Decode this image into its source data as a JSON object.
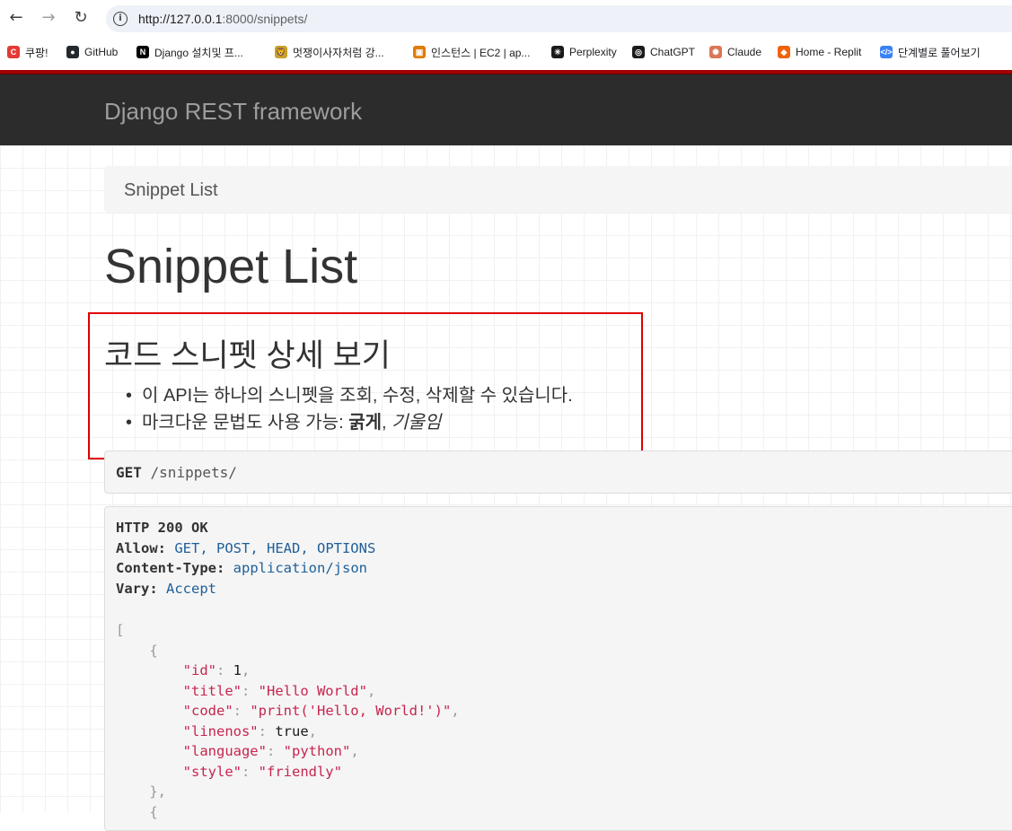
{
  "browser": {
    "url_host": "http://127.0.0.1",
    "url_rest": ":8000/snippets/",
    "bookmarks": [
      {
        "label": "쿠팡!",
        "color": "#e53935",
        "glyph": "C"
      },
      {
        "label": "GitHub",
        "color": "#24292e",
        "glyph": "●"
      },
      {
        "label": "Django 설치및 프...",
        "color": "#000000",
        "glyph": "N"
      },
      {
        "label": "멋쟁이사자처럼 강...",
        "color": "#c9a227",
        "glyph": "🦁"
      },
      {
        "label": "인스턴스 | EC2 | ap...",
        "color": "#e07b00",
        "glyph": "▣"
      },
      {
        "label": "Perplexity",
        "color": "#1a1a1a",
        "glyph": "✳"
      },
      {
        "label": "ChatGPT",
        "color": "#1a1a1a",
        "glyph": "◎"
      },
      {
        "label": "Claude",
        "color": "#d97757",
        "glyph": "✺"
      },
      {
        "label": "Home - Replit",
        "color": "#f26207",
        "glyph": "◆"
      },
      {
        "label": "단계별로 풀어보기",
        "color": "#3b82f6",
        "glyph": "</>"
      }
    ]
  },
  "navbar": {
    "brand": "Django REST framework"
  },
  "breadcrumb": "Snippet List",
  "page_title": "Snippet List",
  "description": {
    "title": "코드 스니펫 상세 보기",
    "item1": "이 API는 하나의 스니펫을 조회, 수정, 삭제할 수 있습니다.",
    "item2_prefix": "마크다운 문법도 사용 가능: ",
    "item2_bold": "굵게",
    "item2_sep": ", ",
    "item2_italic": "기울임"
  },
  "request": {
    "method": "GET",
    "path": " /snippets/"
  },
  "response": {
    "status": "HTTP 200 OK",
    "allow_key": "Allow:",
    "allow_value": "GET, POST, HEAD, OPTIONS",
    "ctype_key": "Content-Type:",
    "ctype_value": "application/json",
    "vary_key": "Vary:",
    "vary_value": "Accept",
    "snippet": {
      "id": "1",
      "title": "\"Hello World\"",
      "code": "\"print('Hello, World!')\"",
      "linenos": "true",
      "language": "\"python\"",
      "style": "\"friendly\""
    }
  }
}
